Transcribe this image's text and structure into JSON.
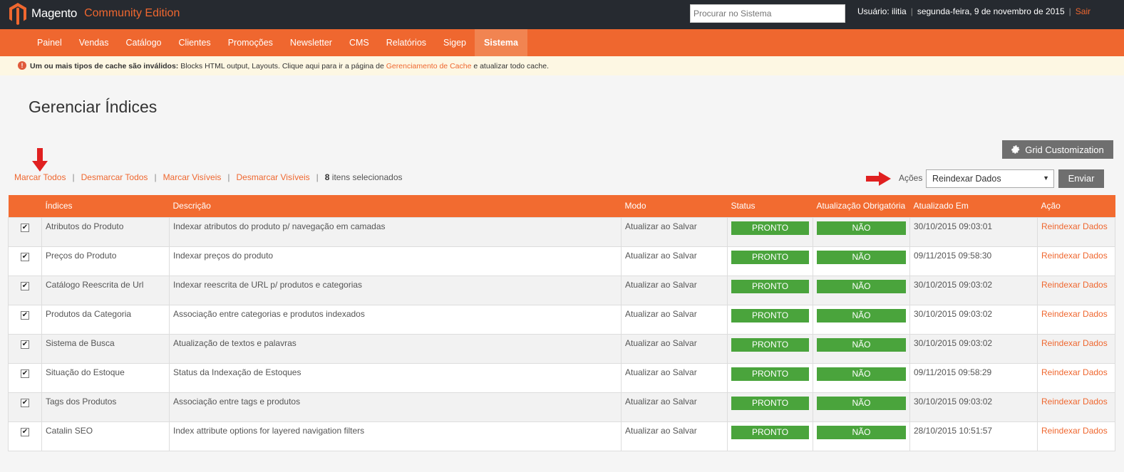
{
  "header": {
    "brand": "Magento",
    "edition": "Community Edition",
    "search_placeholder": "Procurar no Sistema",
    "user_label": "Usuário: ilitia",
    "date": "segunda-feira, 9 de novembro de 2015",
    "logout": "Sair"
  },
  "nav": [
    "Painel",
    "Vendas",
    "Catálogo",
    "Clientes",
    "Promoções",
    "Newsletter",
    "CMS",
    "Relatórios",
    "Sigep",
    "Sistema"
  ],
  "notice": {
    "bold": "Um ou mais tipos de cache são inválidos:",
    "text": " Blocks HTML output, Layouts. Clique aqui para ir a página de ",
    "link": "Gerenciamento de Cache",
    "tail": " e atualizar todo cache."
  },
  "page_title": "Gerenciar Índices",
  "grid_customization": "Grid Customization",
  "massaction": {
    "select_all": "Marcar Todos",
    "unselect_all": "Desmarcar Todos",
    "select_visible": "Marcar Visíveis",
    "unselect_visible": "Desmarcar Visíveis",
    "count": "8",
    "count_label": " itens selecionados",
    "actions_label": "Ações",
    "action_selected": "Reindexar Dados",
    "submit": "Enviar"
  },
  "columns": [
    "Índices",
    "Descrição",
    "Modo",
    "Status",
    "Atualização Obrigatória",
    "Atualizado Em",
    "Ação"
  ],
  "rows": [
    {
      "index": "Atributos do Produto",
      "desc": "Indexar atributos do produto p/ navegação em camadas",
      "mode": "Atualizar ao Salvar",
      "status": "PRONTO",
      "required": "NÃO",
      "updated": "30/10/2015 09:03:01",
      "action": "Reindexar Dados"
    },
    {
      "index": "Preços do Produto",
      "desc": "Indexar preços do produto",
      "mode": "Atualizar ao Salvar",
      "status": "PRONTO",
      "required": "NÃO",
      "updated": "09/11/2015 09:58:30",
      "action": "Reindexar Dados"
    },
    {
      "index": "Catálogo Reescrita de Url",
      "desc": "Indexar reescrita de URL p/ produtos e categorias",
      "mode": "Atualizar ao Salvar",
      "status": "PRONTO",
      "required": "NÃO",
      "updated": "30/10/2015 09:03:02",
      "action": "Reindexar Dados"
    },
    {
      "index": "Produtos da Categoria",
      "desc": "Associação entre categorias e produtos indexados",
      "mode": "Atualizar ao Salvar",
      "status": "PRONTO",
      "required": "NÃO",
      "updated": "30/10/2015 09:03:02",
      "action": "Reindexar Dados"
    },
    {
      "index": "Sistema de Busca",
      "desc": "Atualização de textos e palavras",
      "mode": "Atualizar ao Salvar",
      "status": "PRONTO",
      "required": "NÃO",
      "updated": "30/10/2015 09:03:02",
      "action": "Reindexar Dados"
    },
    {
      "index": "Situação do Estoque",
      "desc": "Status da Indexação de Estoques",
      "mode": "Atualizar ao Salvar",
      "status": "PRONTO",
      "required": "NÃO",
      "updated": "09/11/2015 09:58:29",
      "action": "Reindexar Dados"
    },
    {
      "index": "Tags dos Produtos",
      "desc": "Associação entre tags e produtos",
      "mode": "Atualizar ao Salvar",
      "status": "PRONTO",
      "required": "NÃO",
      "updated": "30/10/2015 09:03:02",
      "action": "Reindexar Dados"
    },
    {
      "index": "Catalin SEO",
      "desc": "Index attribute options for layered navigation filters",
      "mode": "Atualizar ao Salvar",
      "status": "PRONTO",
      "required": "NÃO",
      "updated": "28/10/2015 10:51:57",
      "action": "Reindexar Dados"
    }
  ],
  "colors": {
    "accent": "#ef672f",
    "header": "#262a30",
    "ok": "#4aa43c"
  }
}
